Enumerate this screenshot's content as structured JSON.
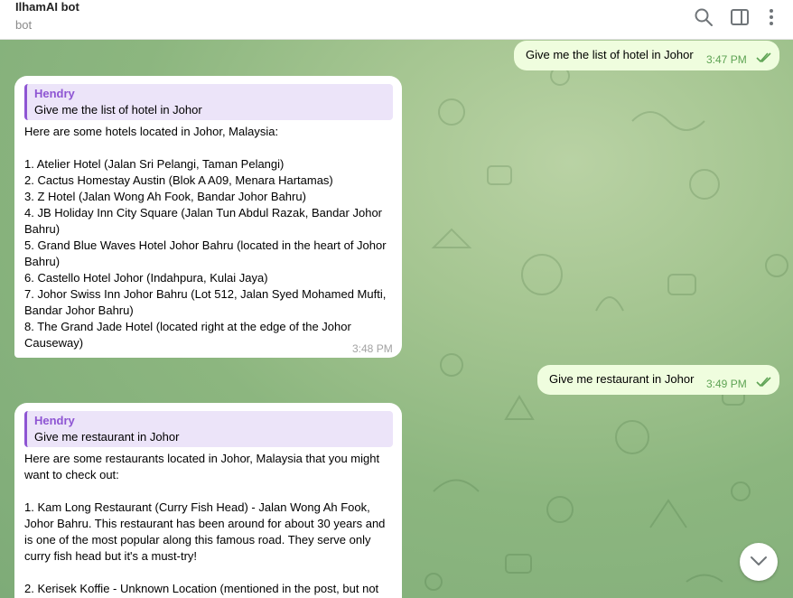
{
  "header": {
    "title": "IlhamAI bot",
    "status": "bot",
    "icons": [
      "search-icon",
      "sidebar-toggle-icon",
      "more-vertical-icon"
    ]
  },
  "messages": {
    "out1": {
      "text": "Give me the list of hotel in Johor",
      "time": "3:47 PM"
    },
    "in1": {
      "reply_name": "Hendry",
      "reply_text": "Give me the list of hotel in Johor",
      "lines": [
        "Here are some hotels located in Johor, Malaysia:",
        "1. Atelier Hotel (Jalan Sri Pelangi, Taman Pelangi)",
        "2. Cactus Homestay Austin (Blok A A09, Menara Hartamas)",
        "3. Z Hotel (Jalan Wong Ah Fook, Bandar Johor Bahru)",
        "4. JB Holiday Inn City Square (Jalan Tun Abdul Razak, Bandar Johor",
        "Bahru)",
        "5. Grand Blue Waves Hotel Johor Bahru (located in the heart of Johor",
        "Bahru)",
        "6. Castello Hotel Johor (Indahpura, Kulai Jaya)",
        "7. Johor Swiss Inn Johor Bahru (Lot 512, Jalan Syed Mohamed Mufti,",
        "Bandar Johor Bahru)",
        "8. The Grand Jade Hotel (located right at the edge of the Johor",
        "Causeway)"
      ],
      "time": "3:48 PM"
    },
    "out2": {
      "text": "Give me restaurant in Johor",
      "time": "3:49 PM"
    },
    "in2": {
      "reply_name": "Hendry",
      "reply_text": "Give me restaurant in Johor",
      "lines": [
        "Here are some restaurants located in Johor, Malaysia that you might",
        "want to check out:",
        "1. Kam Long Restaurant (Curry Fish Head) - Jalan Wong Ah Fook,",
        "Johor Bahru. This restaurant has been around for about 30 years and",
        "is one of the most popular along this famous road. They serve only",
        "curry fish head but it's a must-try!",
        "2. Kerisek Koffie - Unknown Location (mentioned in the post, but not"
      ]
    }
  },
  "colors": {
    "outgoing_bubble": "#effdde",
    "incoming_bubble": "#ffffff",
    "reply_accent": "#8e55d3",
    "time_outgoing": "#5ea354"
  }
}
